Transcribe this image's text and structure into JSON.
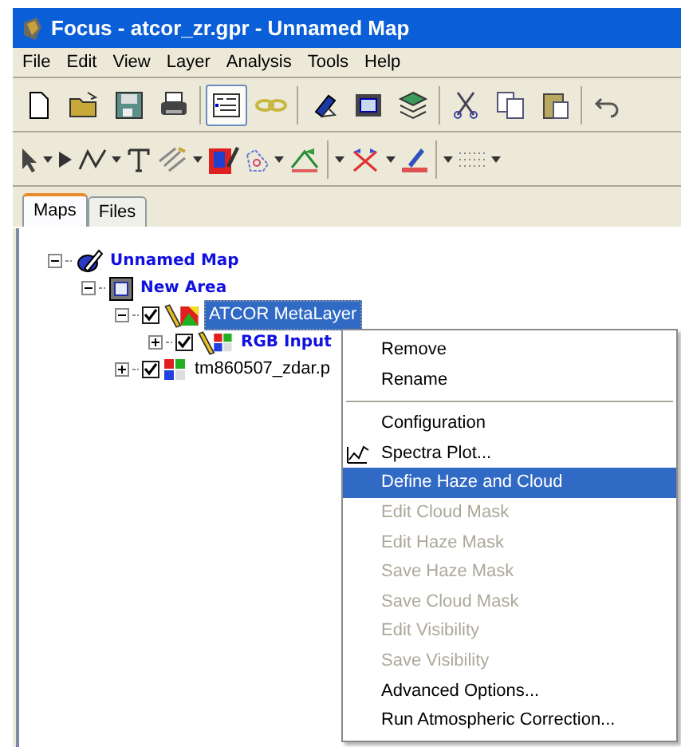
{
  "window": {
    "title": "Focus - atcor_zr.gpr - Unnamed Map"
  },
  "menu_bar": [
    "File",
    "Edit",
    "View",
    "Layer",
    "Analysis",
    "Tools",
    "Help"
  ],
  "toolbar_1": [
    {
      "selected": false
    },
    {
      "selected": false
    },
    {
      "selected": false
    },
    {
      "selected": false
    },
    {
      "selected": true
    },
    {
      "selected": false
    },
    {
      "selected": false
    },
    {
      "selected": false
    },
    {
      "selected": false
    },
    {
      "selected": false
    },
    {
      "selected": false
    },
    {
      "selected": false
    },
    {
      "selected": false
    }
  ],
  "tabs": [
    {
      "label": "Maps",
      "selected": true
    },
    {
      "label": "Files",
      "selected": false
    }
  ],
  "tree": [
    {
      "kind": "map",
      "label": "Unnamed Map",
      "expanded": true,
      "selected": false,
      "children": [
        {
          "kind": "area",
          "label": "New Area",
          "expanded": true,
          "selected": false,
          "children": [
            {
              "kind": "metalayer",
              "label": "ATCOR MetaLayer",
              "expanded": true,
              "checked": true,
              "selected": true,
              "children": [
                {
                  "kind": "input",
                  "label": "RGB Input",
                  "expanded": false,
                  "checked": true,
                  "selected": false
                }
              ]
            },
            {
              "kind": "file",
              "label": "tm860507_zdar.p",
              "expanded": false,
              "checked": true,
              "selected": false
            }
          ]
        }
      ]
    }
  ],
  "context_menu": [
    {
      "kind": "item",
      "label": "Remove",
      "disabled": false,
      "selected": false,
      "has_icon": false
    },
    {
      "kind": "item",
      "label": "Rename",
      "disabled": false,
      "selected": false,
      "has_icon": false
    },
    {
      "kind": "separator"
    },
    {
      "kind": "item",
      "label": "Configuration",
      "disabled": false,
      "selected": false,
      "has_icon": false
    },
    {
      "kind": "item",
      "label": "Spectra Plot...",
      "disabled": false,
      "selected": false,
      "has_icon": true
    },
    {
      "kind": "item",
      "label": "Define Haze and Cloud",
      "disabled": false,
      "selected": true,
      "has_icon": false
    },
    {
      "kind": "item",
      "label": "Edit Cloud Mask",
      "disabled": true,
      "selected": false,
      "has_icon": false
    },
    {
      "kind": "item",
      "label": "Edit Haze Mask",
      "disabled": true,
      "selected": false,
      "has_icon": false
    },
    {
      "kind": "item",
      "label": "Save Haze Mask",
      "disabled": true,
      "selected": false,
      "has_icon": false
    },
    {
      "kind": "item",
      "label": "Save Cloud Mask",
      "disabled": true,
      "selected": false,
      "has_icon": false
    },
    {
      "kind": "item",
      "label": "Edit Visibility",
      "disabled": true,
      "selected": false,
      "has_icon": false
    },
    {
      "kind": "item",
      "label": "Save Visibility",
      "disabled": true,
      "selected": false,
      "has_icon": false
    },
    {
      "kind": "item",
      "label": "Advanced Options...",
      "disabled": false,
      "selected": false,
      "has_icon": false
    },
    {
      "kind": "item",
      "label": "Run Atmospheric Correction...",
      "disabled": false,
      "selected": false,
      "has_icon": false
    }
  ]
}
